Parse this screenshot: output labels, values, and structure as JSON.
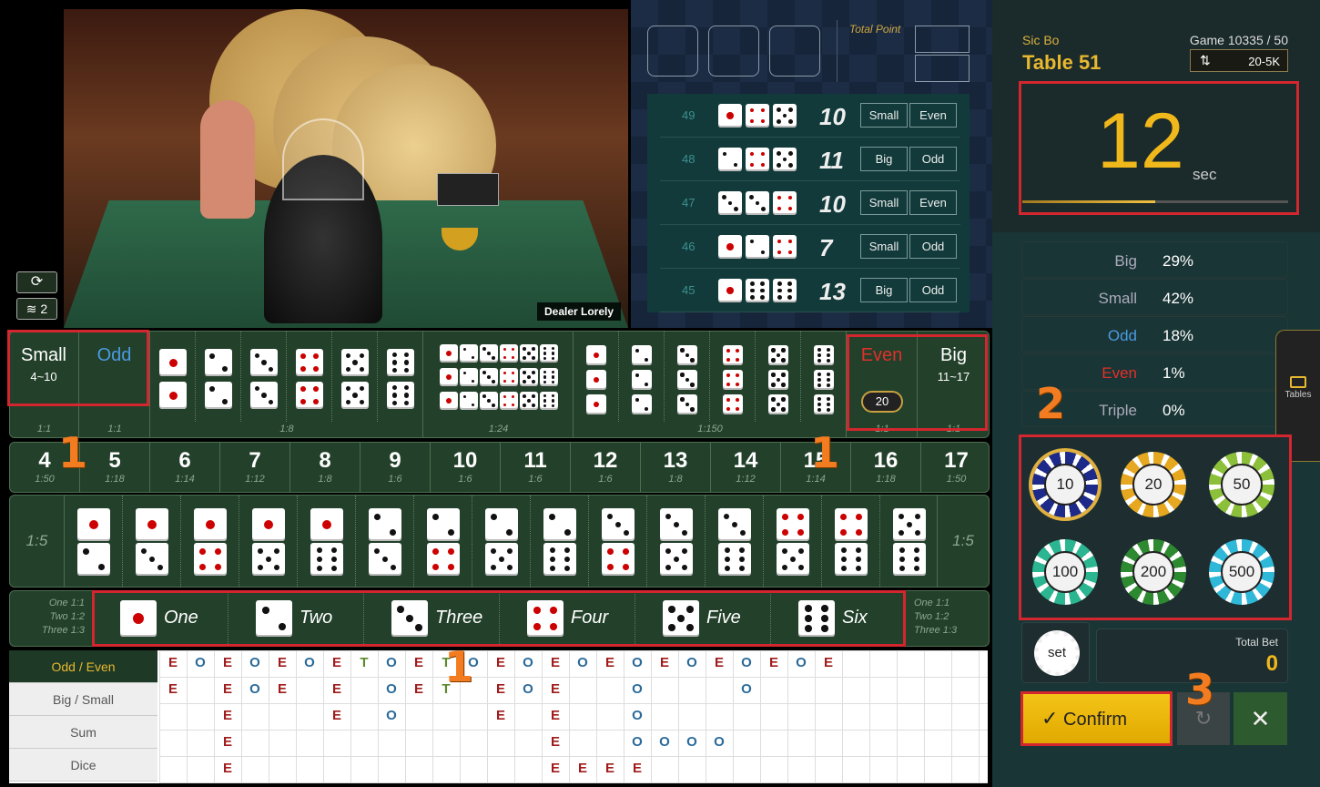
{
  "video": {
    "dealer_label": "Dealer Lorely",
    "signal_count": "2",
    "icons": [
      "refresh-icon",
      "wifi-icon"
    ]
  },
  "results_panel": {
    "total_point_label": "Total Point",
    "rows": [
      {
        "round": "49",
        "dice": [
          1,
          4,
          5
        ],
        "sum": "10",
        "size": "Small",
        "parity": "Even"
      },
      {
        "round": "48",
        "dice": [
          2,
          4,
          5
        ],
        "sum": "11",
        "size": "Big",
        "parity": "Odd"
      },
      {
        "round": "47",
        "dice": [
          3,
          3,
          4
        ],
        "sum": "10",
        "size": "Small",
        "parity": "Even"
      },
      {
        "round": "46",
        "dice": [
          1,
          2,
          4
        ],
        "sum": "7",
        "size": "Small",
        "parity": "Odd"
      },
      {
        "round": "45",
        "dice": [
          1,
          6,
          6
        ],
        "sum": "13",
        "size": "Big",
        "parity": "Odd"
      }
    ]
  },
  "header": {
    "game_type": "Sic Bo",
    "table": "Table 51",
    "game_no": "Game 10335 / 50",
    "limit": "20-5K"
  },
  "timer": {
    "value": "12",
    "unit": "sec",
    "progress_percent": 50
  },
  "stats": [
    {
      "label": "Big",
      "value": "29%",
      "color": "#aab"
    },
    {
      "label": "Small",
      "value": "42%",
      "color": "#aab"
    },
    {
      "label": "Odd",
      "value": "18%",
      "color": "#4a9ae0"
    },
    {
      "label": "Even",
      "value": "1%",
      "color": "#e0302a"
    },
    {
      "label": "Triple",
      "value": "0%",
      "color": "#aab"
    }
  ],
  "tables_tab": "Tables",
  "chips": [
    {
      "value": "10",
      "color": "#1e2a8a",
      "selected": true
    },
    {
      "value": "20",
      "color": "#e6a820"
    },
    {
      "value": "50",
      "color": "#8cc03a"
    },
    {
      "value": "100",
      "color": "#2bb590"
    },
    {
      "value": "200",
      "color": "#2e8a30"
    },
    {
      "value": "500",
      "color": "#30b8d8"
    }
  ],
  "set_label": "set",
  "total_bet": {
    "label": "Total Bet",
    "value": "0"
  },
  "confirm_label": "Confirm",
  "board": {
    "small": {
      "label": "Small",
      "range": "4~10",
      "odds": "1:1"
    },
    "odd": {
      "label": "Odd",
      "odds": "1:1"
    },
    "doubles_odds": "1:8",
    "any_triple_odds": "1:24",
    "triples_odds": "1:150",
    "even": {
      "label": "Even",
      "odds": "1:1",
      "placed_chip": "20"
    },
    "big": {
      "label": "Big",
      "range": "11~17",
      "odds": "1:1"
    },
    "sums": [
      [
        "4",
        "1:50"
      ],
      [
        "5",
        "1:18"
      ],
      [
        "6",
        "1:14"
      ],
      [
        "7",
        "1:12"
      ],
      [
        "8",
        "1:8"
      ],
      [
        "9",
        "1:6"
      ],
      [
        "10",
        "1:6"
      ],
      [
        "11",
        "1:6"
      ],
      [
        "12",
        "1:6"
      ],
      [
        "13",
        "1:8"
      ],
      [
        "14",
        "1:12"
      ],
      [
        "15",
        "1:14"
      ],
      [
        "16",
        "1:18"
      ],
      [
        "17",
        "1:50"
      ]
    ],
    "pairs": [
      [
        1,
        2
      ],
      [
        1,
        3
      ],
      [
        1,
        4
      ],
      [
        1,
        5
      ],
      [
        1,
        6
      ],
      [
        2,
        3
      ],
      [
        2,
        4
      ],
      [
        2,
        5
      ],
      [
        2,
        6
      ],
      [
        3,
        4
      ],
      [
        3,
        5
      ],
      [
        3,
        6
      ],
      [
        4,
        5
      ],
      [
        4,
        6
      ],
      [
        5,
        6
      ]
    ],
    "pair_odds": "1:5",
    "singles": [
      "One",
      "Two",
      "Three",
      "Four",
      "Five",
      "Six"
    ],
    "single_odds": [
      "One 1:1",
      "Two 1:2",
      "Three 1:3"
    ]
  },
  "roadmap": {
    "tabs": [
      "Odd / Even",
      "Big / Small",
      "Sum",
      "Dice"
    ],
    "active_tab": "Odd / Even",
    "grid": [
      "EOEOEOETOETOEOEOEOEOEOEOE",
      "E EOE E OET EOE  O   O",
      "  E   E O   E E  O",
      "  E           E  OOOO",
      "  E           EEEE"
    ],
    "colors": {
      "E": "#a01c1c",
      "O": "#2a6a9a",
      "T": "#5a8a2a"
    }
  },
  "annotations": [
    "1",
    "1",
    "1",
    "2",
    "3"
  ]
}
